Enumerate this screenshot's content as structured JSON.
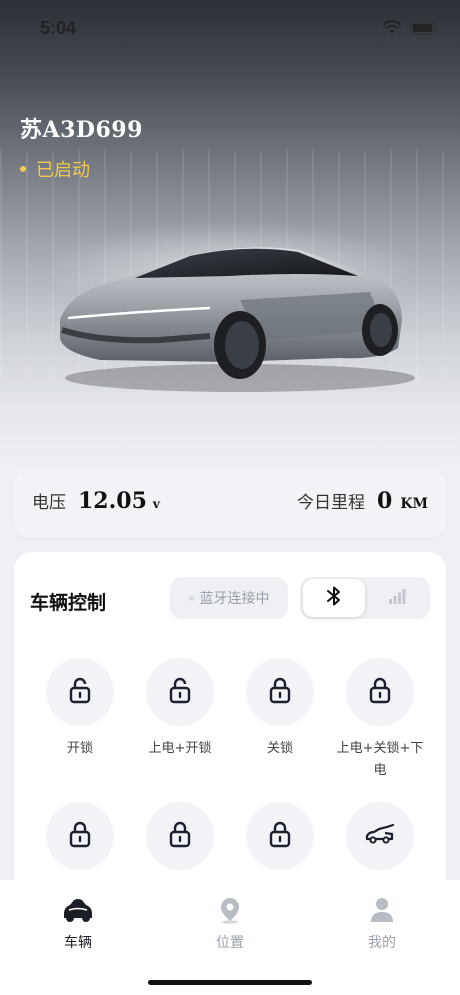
{
  "status_bar": {
    "time": "5:04",
    "wifi_icon": "wifi-icon",
    "battery_icon": "battery-icon"
  },
  "vehicle": {
    "plate": "苏A3D699",
    "engine_status": "已启动",
    "status_color": "#f2c94c"
  },
  "stats": {
    "voltage_label": "电压",
    "voltage_value": "12.05",
    "voltage_unit": "v",
    "mileage_label": "今日里程",
    "mileage_value": "0",
    "mileage_unit": "KM"
  },
  "control": {
    "title": "车辆控制",
    "bluetooth_status": "蓝牙连接中",
    "connection_options": [
      {
        "icon": "bluetooth-icon",
        "active": true
      },
      {
        "icon": "signal-icon",
        "active": false
      }
    ],
    "buttons": [
      {
        "icon": "unlock-icon",
        "label": "开锁"
      },
      {
        "icon": "unlock-icon",
        "label": "上电+开锁"
      },
      {
        "icon": "lock-icon",
        "label": "关锁"
      },
      {
        "icon": "lock-icon",
        "label": "上电+关锁+下电"
      },
      {
        "icon": "lock-icon",
        "label": ""
      },
      {
        "icon": "lock-icon",
        "label": ""
      },
      {
        "icon": "lock-icon",
        "label": ""
      },
      {
        "icon": "trunk-icon",
        "label": ""
      }
    ]
  },
  "bottom_nav": {
    "items": [
      {
        "icon": "car-icon",
        "label": "车辆",
        "active": true
      },
      {
        "icon": "location-icon",
        "label": "位置",
        "active": false
      },
      {
        "icon": "profile-icon",
        "label": "我的",
        "active": false
      }
    ],
    "active_color": "#1c1f26",
    "inactive_color": "#9aa0a8"
  }
}
